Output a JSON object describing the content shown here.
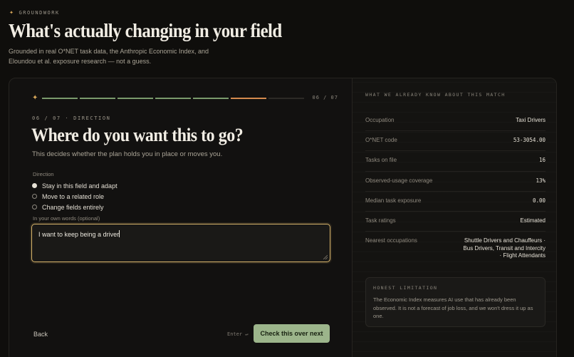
{
  "brand": {
    "name": "GROUNDWORK",
    "icon": "spark-glyph-icon"
  },
  "header": {
    "title": "What's actually changing in your field",
    "subtitle": "Grounded in real O*NET task data, the Anthropic Economic Index, and Eloundou et al. exposure research — not a guess."
  },
  "progress": {
    "current": 6,
    "total": 7,
    "label": "06 / 07",
    "completed_steps": 5
  },
  "question": {
    "step_label": "06 / 07 · DIRECTION",
    "title": "Where do you want this to go?",
    "subtitle": "This decides whether the plan holds you in place or moves you.",
    "direction_label": "Direction",
    "options": [
      {
        "label": "Stay in this field and adapt",
        "selected": true
      },
      {
        "label": "Move to a related role",
        "selected": false
      },
      {
        "label": "Change fields entirely",
        "selected": false
      }
    ],
    "own_words_label": "In your own words (optional)",
    "own_words_value": "I want to keep being a driver"
  },
  "footer": {
    "back_label": "Back",
    "enter_hint": "Enter ↵",
    "next_label": "Check this over next"
  },
  "panel": {
    "heading": "WHAT WE ALREADY KNOW ABOUT THIS MATCH",
    "rows": [
      {
        "key": "Occupation",
        "value": "Taxi Drivers"
      },
      {
        "key": "O*NET code",
        "value": "53-3054.00"
      },
      {
        "key": "Tasks on file",
        "value": "16"
      },
      {
        "key": "Observed-usage coverage",
        "value": "13%"
      },
      {
        "key": "Median task exposure",
        "value": "0.00"
      },
      {
        "key": "Task ratings",
        "value": "Estimated"
      },
      {
        "key": "Nearest occupations",
        "value": "Shuttle Drivers and Chauffeurs · Bus Drivers, Transit and Intercity · Flight Attendants"
      }
    ],
    "limitation": {
      "heading": "HONEST LIMITATION",
      "text": "The Economic Index measures AI use that has already been observed. It is not a forecast of job loss, and we won't dress it up as one."
    }
  },
  "colors": {
    "accent_gold": "#d9b56b",
    "progress_done": "#7a9a6c",
    "progress_current": "#d48a4e",
    "button_green": "#9cb58b"
  }
}
